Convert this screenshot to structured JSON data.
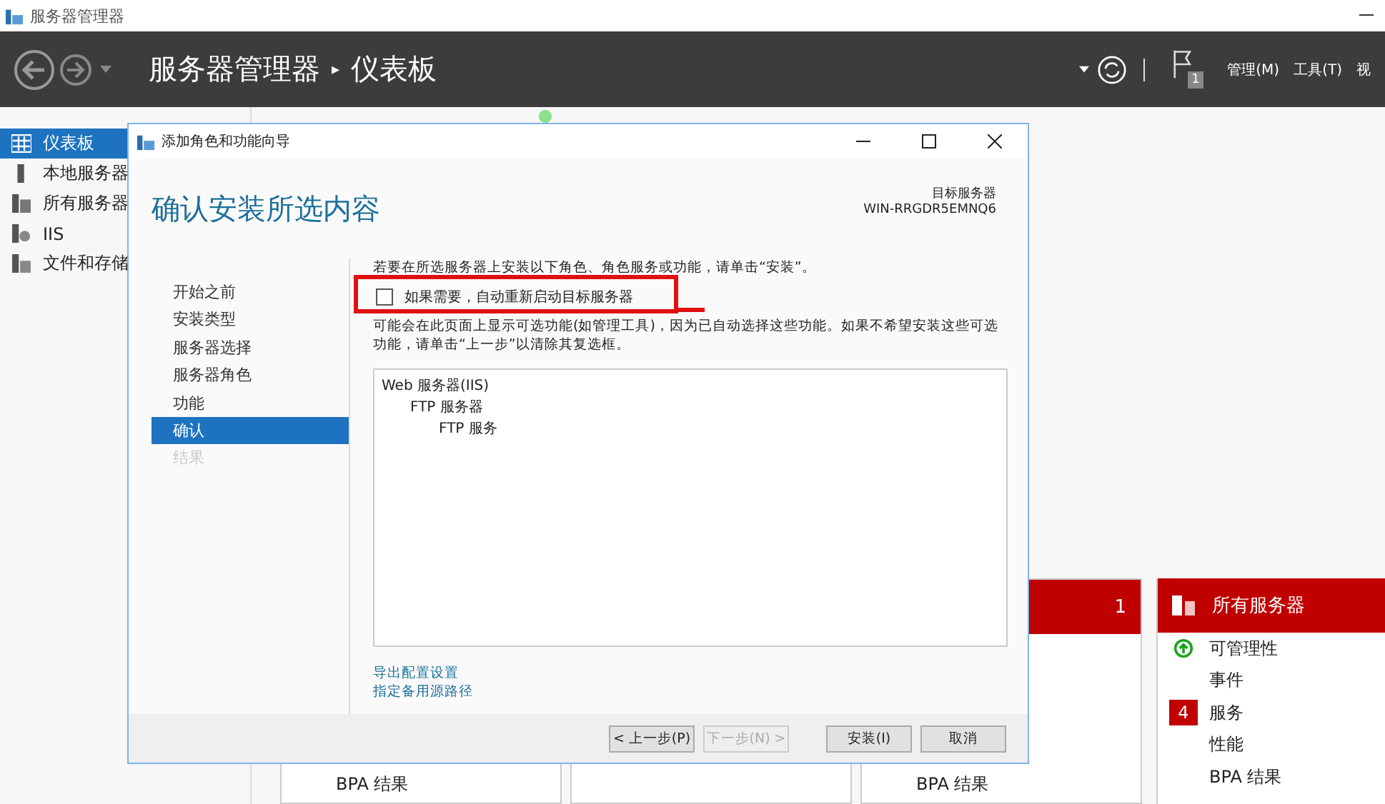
{
  "window": {
    "title": "服务器管理器"
  },
  "header": {
    "app": "服务器管理器",
    "separator": "▸",
    "page": "仪表板",
    "flag_count": "1",
    "menus": [
      "管理(M)",
      "工具(T)",
      "视"
    ]
  },
  "sidebar": {
    "items": [
      {
        "label": "仪表板",
        "kind": "dashboard",
        "selected": true
      },
      {
        "label": "本地服务器",
        "kind": "local",
        "selected": false
      },
      {
        "label": "所有服务器",
        "kind": "all",
        "selected": false
      },
      {
        "label": "IIS",
        "kind": "role",
        "selected": false
      },
      {
        "label": "文件和存储",
        "kind": "storage",
        "selected": false
      }
    ]
  },
  "tiles": [
    {
      "kind": "role",
      "footer": "BPA 结果"
    },
    {
      "kind": "role"
    },
    {
      "kind": "role",
      "count": "1",
      "footer": "BPA 结果"
    }
  ],
  "server_card": {
    "title": "所有服务器",
    "rows": [
      {
        "label": "可管理性",
        "kind": "ok"
      },
      {
        "label": "事件",
        "kind": "plain"
      },
      {
        "label": "服务",
        "kind": "alert",
        "badge": "4"
      },
      {
        "label": "性能",
        "kind": "plain"
      },
      {
        "label": "BPA 结果",
        "kind": "plain"
      }
    ]
  },
  "dialog": {
    "title": "添加角色和功能向导",
    "heading": "确认安装所选内容",
    "target_label": "目标服务器",
    "target_name": "WIN-RRGDR5EMNQ6",
    "steps": [
      {
        "label": "开始之前",
        "selected": false,
        "disabled": false
      },
      {
        "label": "安装类型",
        "selected": false,
        "disabled": false
      },
      {
        "label": "服务器选择",
        "selected": false,
        "disabled": false
      },
      {
        "label": "服务器角色",
        "selected": false,
        "disabled": false
      },
      {
        "label": "功能",
        "selected": false,
        "disabled": false
      },
      {
        "label": "确认",
        "selected": true,
        "disabled": false
      },
      {
        "label": "结果",
        "selected": false,
        "disabled": true
      }
    ],
    "intro": "若要在所选服务器上安装以下角色、角色服务或功能，请单击“安装”。",
    "restart": {
      "label": "如果需要，自动重新启动目标服务器",
      "checked": false,
      "highlighted": true
    },
    "note": "可能会在此页面上显示可选功能(如管理工具)，因为已自动选择这些功能。如果不希望安装这些可选功能，请单击“上一步”以清除其复选框。",
    "features": [
      {
        "label": "Web 服务器(IIS)",
        "children": [
          {
            "label": "FTP 服务器",
            "children": [
              {
                "label": "FTP 服务"
              }
            ]
          }
        ]
      }
    ],
    "links": [
      "导出配置设置",
      "指定备用源路径"
    ],
    "buttons": [
      {
        "label": "< 上一步(P)",
        "disabled": false
      },
      {
        "label": "下一步(N) >",
        "disabled": true
      },
      {
        "label": "安装(I)",
        "disabled": false
      },
      {
        "label": "取消",
        "disabled": false
      }
    ]
  }
}
